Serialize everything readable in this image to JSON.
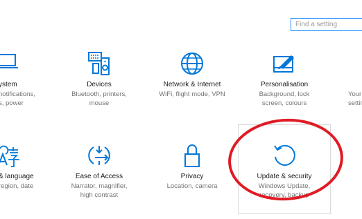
{
  "search": {
    "placeholder": "Find a setting"
  },
  "tiles": [
    {
      "title": "ystem",
      "desc": [
        "notifications,",
        "s, power"
      ],
      "icon": "laptop-icon"
    },
    {
      "title": "Devices",
      "desc": [
        "Bluetooth, printers,",
        "mouse"
      ],
      "icon": "devices-icon"
    },
    {
      "title": "Network & Internet",
      "desc": [
        "WiFi, flight mode, VPN"
      ],
      "icon": "globe-icon"
    },
    {
      "title": "Personalisation",
      "desc": [
        "Background, lock",
        "screen, colours"
      ],
      "icon": "paint-icon"
    },
    {
      "title": "",
      "desc": [
        "Your",
        "settir"
      ],
      "icon": ""
    },
    {
      "title": "& language",
      "desc": [
        "region, date"
      ],
      "icon": "language-icon"
    },
    {
      "title": "Ease of Access",
      "desc": [
        "Narrator, magnifier,",
        "high contrast"
      ],
      "icon": "ease-of-access-icon"
    },
    {
      "title": "Privacy",
      "desc": [
        "Location, camera"
      ],
      "icon": "lock-icon"
    },
    {
      "title": "Update & security",
      "desc": [
        "Windows Update,",
        "recovery, backup"
      ],
      "icon": "refresh-icon"
    }
  ],
  "colors": {
    "accent": "#0078d7",
    "annotation": "#e01b24",
    "focus": "#1e90ff"
  }
}
